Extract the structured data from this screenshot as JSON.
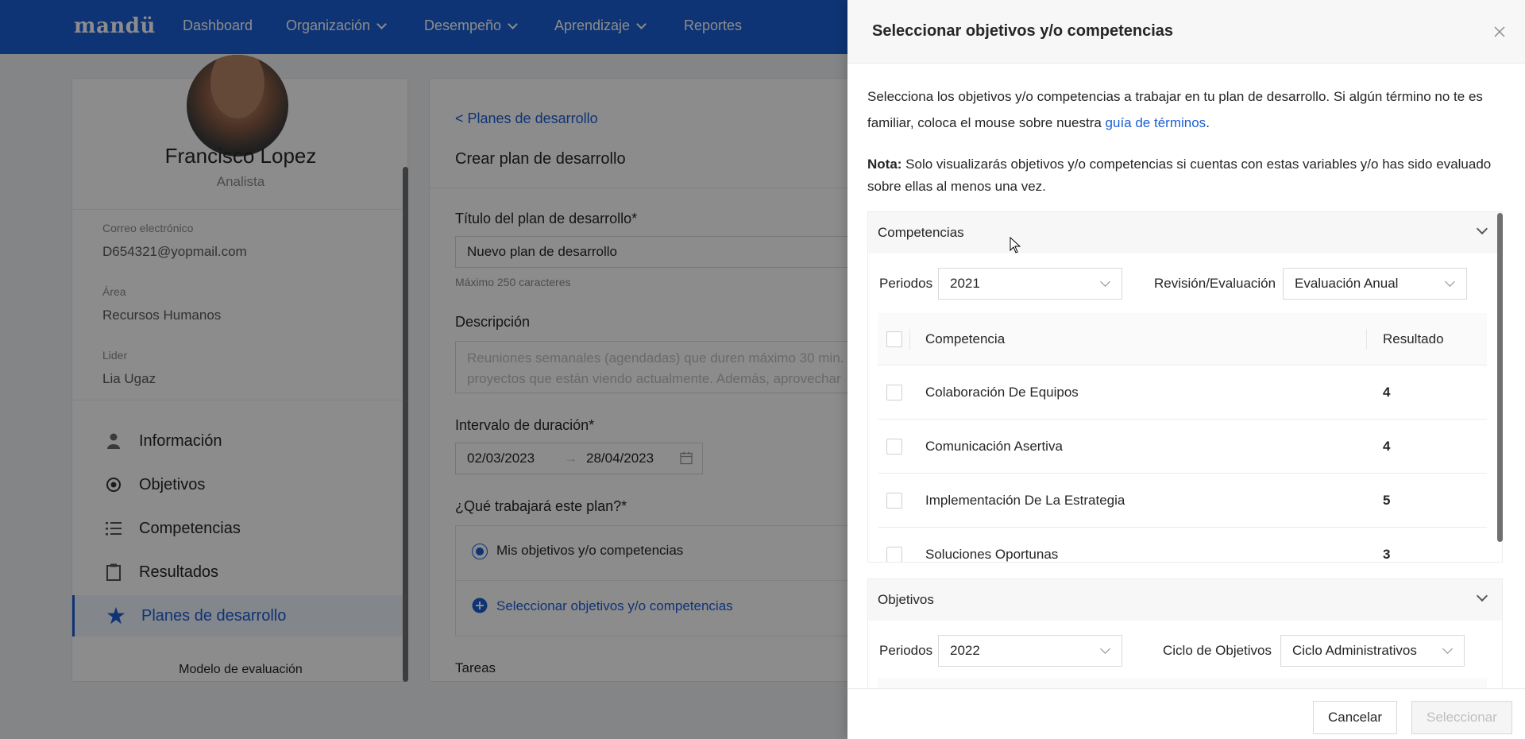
{
  "app": {
    "logo": "mandü"
  },
  "nav": {
    "items": [
      {
        "label": "Dashboard",
        "dropdown": false
      },
      {
        "label": "Organización",
        "dropdown": true
      },
      {
        "label": "Desempeño",
        "dropdown": true
      },
      {
        "label": "Aprendizaje",
        "dropdown": true
      },
      {
        "label": "Reportes",
        "dropdown": false
      }
    ]
  },
  "profile": {
    "name": "Francisco Lopez",
    "role": "Analista",
    "email_label": "Correo electrónico",
    "email": "D654321@yopmail.com",
    "area_label": "Área",
    "area": "Recursos Humanos",
    "leader_label": "Lider",
    "leader": "Lia Ugaz",
    "menu": [
      {
        "label": "Información",
        "icon": "user-icon"
      },
      {
        "label": "Objetivos",
        "icon": "target-icon"
      },
      {
        "label": "Competencias",
        "icon": "list-icon"
      },
      {
        "label": "Resultados",
        "icon": "clipboard-icon"
      },
      {
        "label": "Planes de desarrollo",
        "icon": "star-icon",
        "active": true
      }
    ],
    "model_label": "Modelo de evaluación"
  },
  "plan": {
    "back": "< Planes de desarrollo",
    "title": "Crear plan de desarrollo",
    "title_label": "Título del plan de desarrollo*",
    "title_value": "Nuevo plan de desarrollo",
    "title_hint": "Máximo 250 caracteres",
    "desc_label": "Descripción",
    "desc_line1": "Reuniones semanales (agendadas) que duren máximo 30 min.",
    "desc_line2": "proyectos que están viendo actualmente. Además, aprovechar",
    "interval_label": "Intervalo de duración*",
    "date_start": "02/03/2023",
    "date_arrow": "→",
    "date_end": "28/04/2023",
    "work_label": "¿Qué trabajará este plan?*",
    "radio_label": "Mis objetivos y/o competencias",
    "select_link": "Seleccionar objetivos y/o competencias",
    "tasks_label": "Tareas"
  },
  "drawer": {
    "title": "Seleccionar objetivos y/o competencias",
    "intro_text": "Selecciona los objetivos y/o competencias a trabajar en tu plan de desarrollo. Si algún término no te es familiar, coloca el mouse sobre nuestra ",
    "intro_link": "guía de términos",
    "intro_end": ".",
    "note_bold": "Nota:",
    "note_text": " Solo visualizarás objetivos y/o competencias si cuentas con estas variables y/o has sido evaluado sobre ellas al menos una vez.",
    "competencias": {
      "title": "Competencias",
      "period_label": "Periodos",
      "period_value": "2021",
      "review_label": "Revisión/Evaluación",
      "review_value": "Evaluación Anual",
      "col_competencia": "Competencia",
      "col_resultado": "Resultado",
      "rows": [
        {
          "name": "Colaboración De Equipos",
          "result": "4"
        },
        {
          "name": "Comunicación Asertiva",
          "result": "4"
        },
        {
          "name": "Implementación De La Estrategia",
          "result": "5"
        },
        {
          "name": "Soluciones Oportunas",
          "result": "3"
        }
      ]
    },
    "objetivos": {
      "title": "Objetivos",
      "period_label": "Periodos",
      "period_value": "2022",
      "cycle_label": "Ciclo de Objetivos",
      "cycle_value": "Ciclo Administrativos"
    },
    "cancel": "Cancelar",
    "select": "Seleccionar"
  },
  "colors": {
    "primary": "#1b5fd6",
    "overlay": "rgba(0,0,0,0.45)"
  }
}
